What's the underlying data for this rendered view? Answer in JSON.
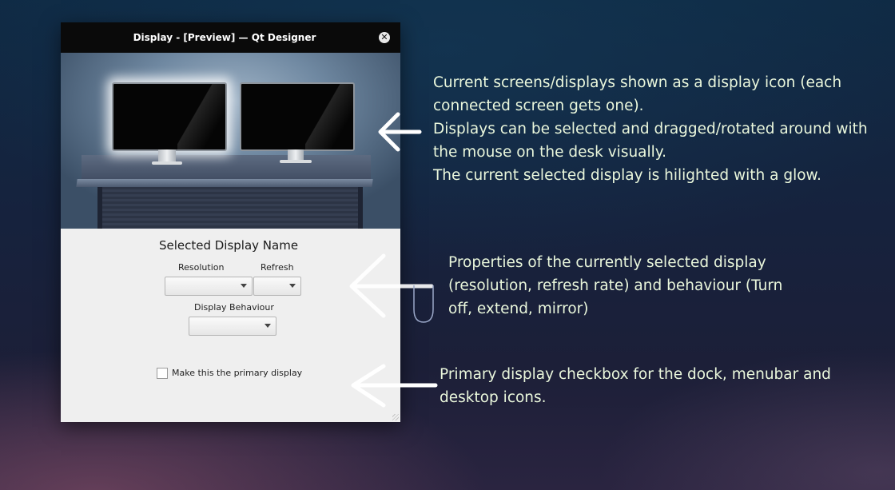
{
  "window": {
    "title": "Display - [Preview] — Qt Designer",
    "close_glyph": "✕"
  },
  "scene": {
    "monitors": [
      {
        "selected": true
      },
      {
        "selected": false
      }
    ]
  },
  "panel": {
    "selected_display_name": "Selected Display Name",
    "resolution_label": "Resolution",
    "refresh_label": "Refresh",
    "resolution_value": "",
    "refresh_value": "",
    "behaviour_label": "Display Behaviour",
    "behaviour_value": "",
    "primary_checkbox_label": "Make this the primary display",
    "primary_checked": false
  },
  "annotations": {
    "screens": "Current screens/displays shown as a display icon (each\nconnected screen gets one).\nDisplays can be selected and dragged/rotated around with\nthe mouse on the desk visually.\nThe current selected display is hilighted with a glow.",
    "properties": "Properties of the currently selected display\n(resolution, refresh rate) and behaviour (Turn\noff, extend, mirror)",
    "primary": "Primary display checkbox for the dock, menubar and\ndesktop icons."
  },
  "colors": {
    "annotation_text": "#eaf7dc",
    "titlebar": "#0a0a0a",
    "panel_bg": "#efefef"
  }
}
